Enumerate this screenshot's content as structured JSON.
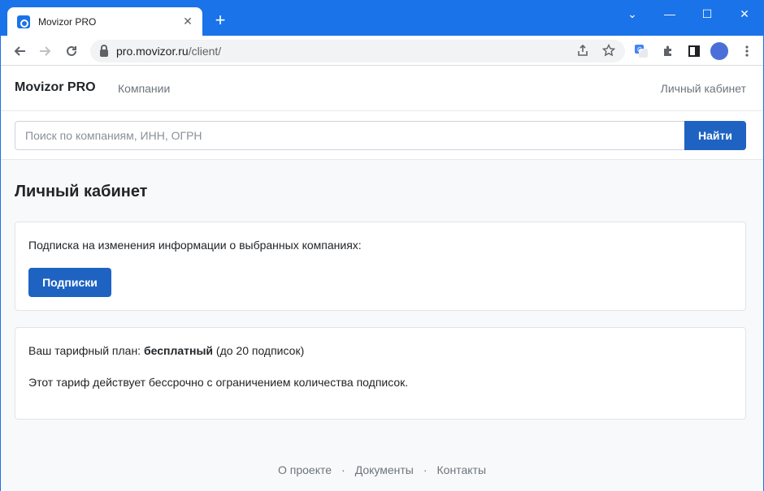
{
  "browser": {
    "tab_title": "Movizor PRO",
    "tab_close": "✕",
    "new_tab": "+",
    "url_host": "pro.movizor.ru",
    "url_path": "/client/",
    "window_controls": {
      "minimize": "—",
      "maximize": "☐",
      "close": "✕",
      "tab_menu": "⌄"
    }
  },
  "navbar": {
    "brand": "Movizor PRO",
    "companies_link": "Компании",
    "cabinet_link": "Личный кабинет"
  },
  "search": {
    "placeholder": "Поиск по компаниям, ИНН, ОГРН",
    "button_label": "Найти"
  },
  "main": {
    "title": "Личный кабинет",
    "subscriptions_card": {
      "text": "Подписка на изменения информации о выбранных компаниях:",
      "button_label": "Подписки"
    },
    "tariff_card": {
      "prefix": "Ваш тарифный план: ",
      "plan_name": "бесплатный",
      "suffix": " (до 20 подписок)",
      "description": "Этот тариф действует бессрочно с ограничением количества подписок."
    }
  },
  "footer": {
    "about": "О проекте",
    "documents": "Документы",
    "contacts": "Контакты",
    "separator": "·"
  },
  "colors": {
    "chrome_accent": "#1a73e8",
    "primary_button": "#1f63c2"
  }
}
